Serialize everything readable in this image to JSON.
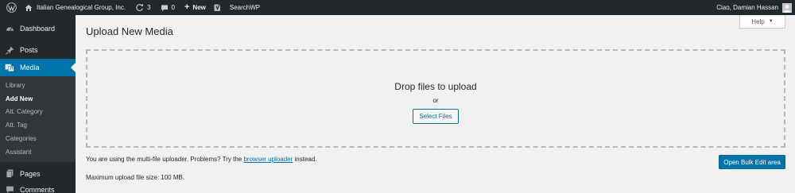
{
  "admin_bar": {
    "site_name": "Italian Genealogical Group, Inc.",
    "updates_count": "3",
    "comments_count": "0",
    "new_label": "New",
    "new_plus": "+",
    "searchwp_label": "SearchWP",
    "greeting": "Ciao, Damian Hassan",
    "icons": [
      "wordpress-logo-icon",
      "home-icon",
      "updates-icon",
      "comments-icon",
      "yoast-icon",
      "avatar"
    ]
  },
  "sidebar": {
    "items": [
      {
        "label": "Dashboard",
        "icon": "dashboard-icon"
      },
      {
        "label": "Posts",
        "icon": "pin-icon"
      },
      {
        "label": "Media",
        "icon": "media-icon",
        "current": true
      }
    ],
    "submenu": [
      {
        "label": "Library"
      },
      {
        "label": "Add New",
        "current": true
      },
      {
        "label": "Att. Category"
      },
      {
        "label": "Att. Tag"
      },
      {
        "label": "Categories"
      },
      {
        "label": "Assistant"
      }
    ],
    "bottom_items": [
      {
        "label": "Pages",
        "icon": "pages-icon"
      },
      {
        "label": "Comments",
        "icon": "comments-icon"
      }
    ]
  },
  "main": {
    "title": "Upload New Media",
    "help_label": "Help",
    "help_caret": "▼",
    "drop_title": "Drop files to upload",
    "drop_or": "or",
    "select_files_label": "Select Files",
    "note_prefix": "You are using the multi-file uploader. Problems? Try the ",
    "note_link": "browser uploader",
    "note_suffix": " instead.",
    "max_size": "Maximum upload file size: 100 MB.",
    "bulk_edit_label": "Open Bulk Edit area"
  },
  "colors": {
    "admin_bar_bg": "#23282d",
    "accent": "#0073aa",
    "page_bg": "#f1f1f1"
  }
}
